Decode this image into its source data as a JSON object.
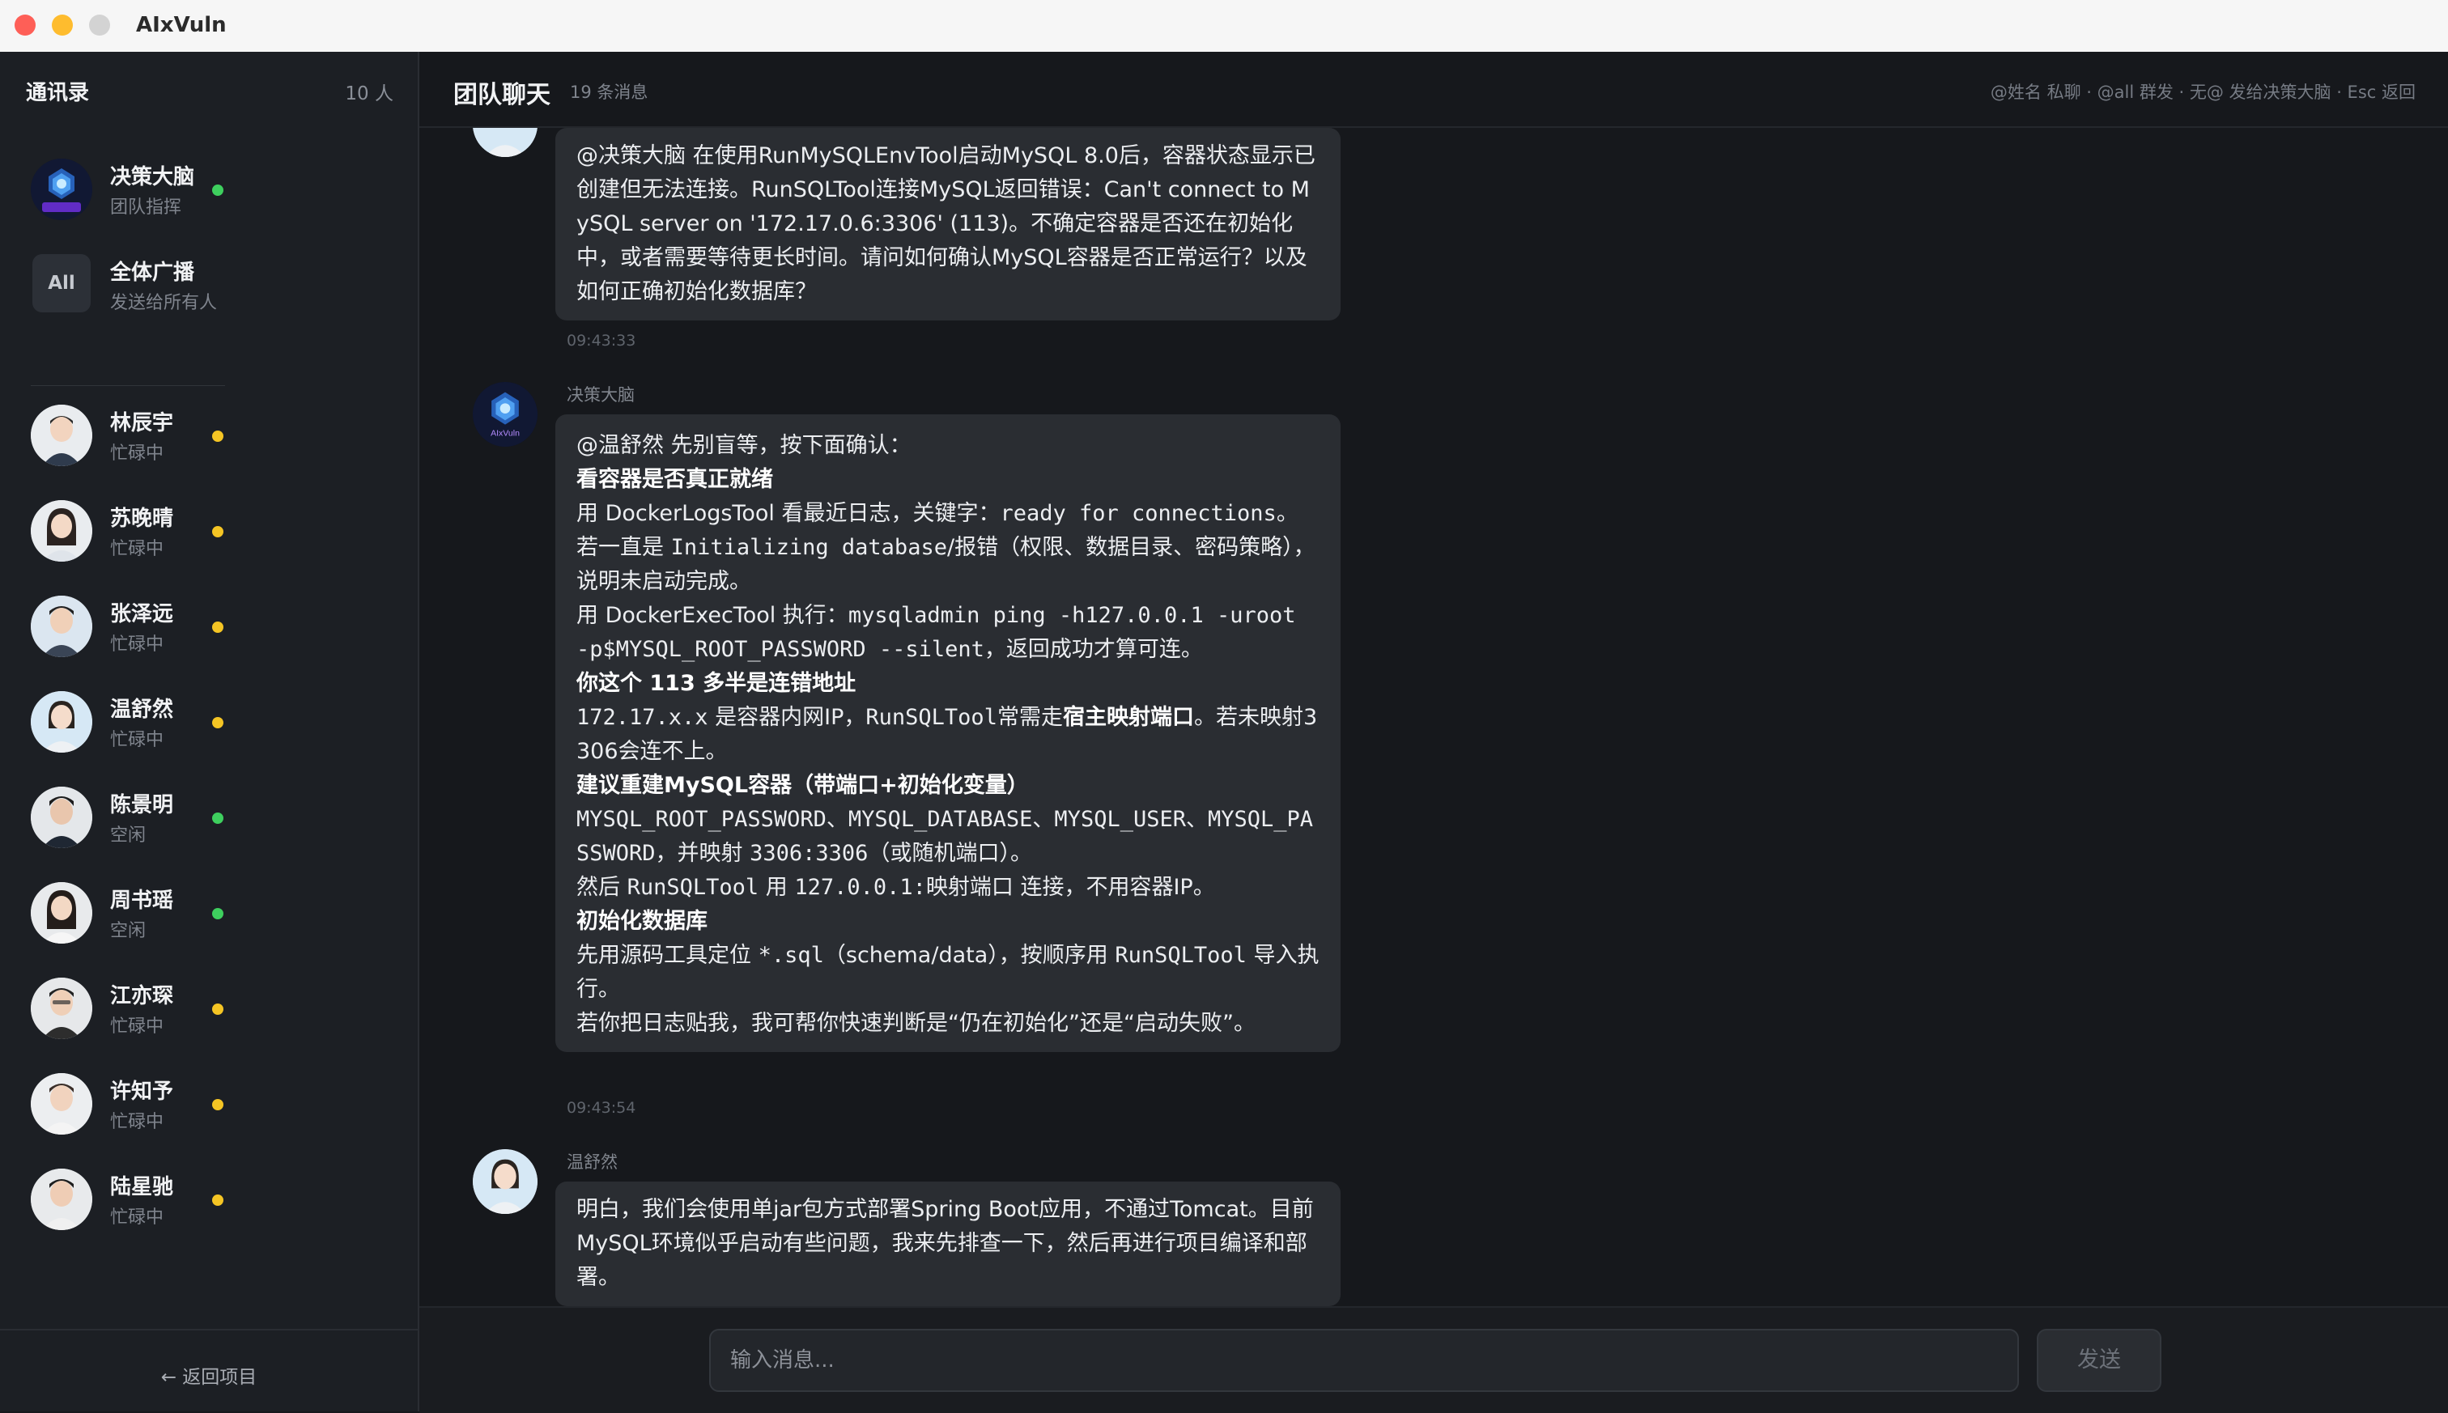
{
  "window": {
    "title": "AIxVuln"
  },
  "sidebar": {
    "title": "通讯录",
    "count": "10 人",
    "items": [
      {
        "name": "决策大脑",
        "status": "团队指挥",
        "presence": "green"
      },
      {
        "name": "全体广播",
        "status": "发送给所有人",
        "badge": "All"
      },
      {
        "name": "林辰宇",
        "status": "忙碌中",
        "presence": "yellow"
      },
      {
        "name": "苏晚晴",
        "status": "忙碌中",
        "presence": "yellow"
      },
      {
        "name": "张泽远",
        "status": "忙碌中",
        "presence": "yellow"
      },
      {
        "name": "温舒然",
        "status": "忙碌中",
        "presence": "yellow"
      },
      {
        "name": "陈景明",
        "status": "空闲",
        "presence": "green"
      },
      {
        "name": "周书瑶",
        "status": "空闲",
        "presence": "green"
      },
      {
        "name": "江亦琛",
        "status": "忙碌中",
        "presence": "yellow"
      },
      {
        "name": "许知予",
        "status": "忙碌中",
        "presence": "yellow"
      },
      {
        "name": "陆星驰",
        "status": "忙碌中",
        "presence": "yellow"
      }
    ],
    "back_label": "← 返回项目"
  },
  "chat": {
    "title": "团队聊天",
    "count": "19 条消息",
    "hint": "@姓名 私聊 · @all 群发 · 无@ 发给决策大脑 · Esc 返回",
    "logo_text": "AIxVuln",
    "messages": [
      {
        "body": "@决策大脑 在使用RunMySQLEnvTool启动MySQL 8.0后，容器状态显示已创建但无法连接。RunSQLTool连接MySQL返回错误：Can't connect to MySQL server on '172.17.0.6:3306' (113)。不确定容器是否还在初始化中，或者需要等待更长时间。请问如何确认MySQL容器是否正常运行？以及如何正确初始化数据库？",
        "time": "09:43:33"
      },
      {
        "sender": "决策大脑",
        "lines": {
          "l1": "@温舒然 先别盲等，按下面确认：",
          "h1": "看容器是否真正就绪",
          "l2a": "用 DockerLogsTool 看最近日志，关键字：",
          "l2b": "ready for connections",
          "l2c": "。",
          "l3a": "若一直是 ",
          "l3b": "Initializing database",
          "l3c": "/报错（权限、数据目录、密码策略），说明未启动完成。",
          "l4a": "用 DockerExecTool 执行：",
          "l4b": "mysqladmin ping -h127.0.0.1 -uroot -p$MYSQL_ROOT_PASSWORD --silent",
          "l4c": "，返回成功才算可连。",
          "h2": "你这个 113 多半是连错地址",
          "l5a": "172.17.x.x",
          "l5b": " 是容器内网IP，",
          "l5c": "RunSQLTool",
          "l5d": "常需走",
          "l5e": "宿主映射端口",
          "l5f": "。若未映射3306会连不上。",
          "h3": "建议重建MySQL容器（带端口+初始化变量）",
          "l6a": "MYSQL_ROOT_PASSWORD、MYSQL_DATABASE、MYSQL_USER、MYSQL_PASSWORD",
          "l6b": "，并映射 ",
          "l6c": "3306:3306",
          "l6d": "（或随机端口）。",
          "l7a": "然后 ",
          "l7b": "RunSQLTool",
          "l7c": " 用 ",
          "l7d": "127.0.0.1:映射端口",
          "l7e": " 连接，不用容器IP。",
          "h4": "初始化数据库",
          "l8a": "先用源码工具定位 ",
          "l8b": "*.sql",
          "l8c": "（schema/data），按顺序用 ",
          "l8d": "RunSQLTool",
          "l8e": " 导入执行。",
          "l9": "若你把日志贴我，我可帮你快速判断是“仍在初始化”还是“启动失败”。"
        },
        "time": "09:43:54"
      },
      {
        "sender": "温舒然",
        "body": "明白，我们会使用单jar包方式部署Spring Boot应用，不通过Tomcat。目前MySQL环境似乎启动有些问题，我来先排查一下，然后再进行项目编译和部署。"
      }
    ],
    "input_placeholder": "输入消息...",
    "send_label": "发送"
  },
  "icons": {
    "brain": "ai-logo-icon",
    "person": "person-avatar-icon"
  },
  "colors": {
    "online": "#3ecf5e",
    "busy": "#f5c524",
    "bubble": "#2a2d32"
  }
}
